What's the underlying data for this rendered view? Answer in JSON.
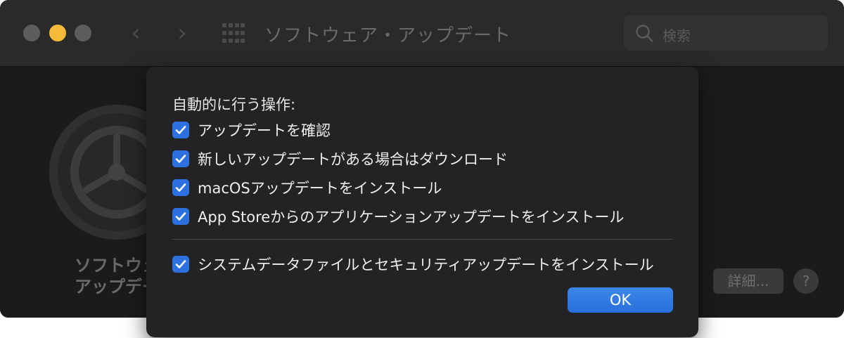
{
  "window": {
    "title": "ソフトウェア・アップデート",
    "back_icon": "‹",
    "forward_icon": "›"
  },
  "search": {
    "placeholder": "検索"
  },
  "background": {
    "label_line1": "ソフトウェ",
    "label_line2": "アップデー",
    "details_button": "詳細...",
    "help_button": "?"
  },
  "sheet": {
    "heading": "自動的に行う操作:",
    "options": [
      {
        "label": "アップデートを確認",
        "checked": true
      },
      {
        "label": "新しいアップデートがある場合はダウンロード",
        "checked": true
      },
      {
        "label": "macOSアップデートをインストール",
        "checked": true
      },
      {
        "label": "App Storeからのアプリケーションアップデートをインストール",
        "checked": true
      },
      {
        "label": "システムデータファイルとセキュリティアップデートをインストール",
        "checked": true
      }
    ],
    "ok_button": "OK"
  },
  "colors": {
    "accent": "#2d71e0",
    "traffic_min": "#f5bb37",
    "sheet_bg": "#232325"
  }
}
